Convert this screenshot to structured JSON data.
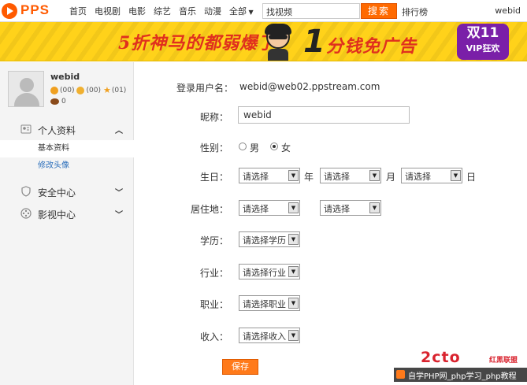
{
  "topbar": {
    "logo_text": "PPS",
    "nav": [
      "首页",
      "电视剧",
      "电影",
      "综艺",
      "音乐",
      "动漫",
      "全部"
    ],
    "search_placeholder": "找视频",
    "search_button": "搜索",
    "rank_link": "排行榜",
    "user": "webid"
  },
  "banner": {
    "text1": "5折神马的都弱爆了",
    "big_number": "1",
    "text2": "分钱免广告",
    "badge_line1": "双11",
    "badge_line2": "VIP狂欢"
  },
  "sidebar": {
    "username": "webid",
    "stats": [
      {
        "value": "(00)",
        "icon": "smile-icon",
        "color": "#f0a020"
      },
      {
        "value": "(00)",
        "icon": "moon-icon",
        "color": "#f0b030"
      },
      {
        "value": "(01)",
        "icon": "star-icon",
        "color": "#f0a020"
      }
    ],
    "coins": "0",
    "menu": [
      {
        "label": "个人资料",
        "icon": "profile-icon",
        "expanded": true,
        "items": [
          {
            "label": "基本资料",
            "active": true
          },
          {
            "label": "修改头像",
            "active": false
          }
        ]
      },
      {
        "label": "安全中心",
        "icon": "shield-icon",
        "expanded": false
      },
      {
        "label": "影视中心",
        "icon": "film-reel-icon",
        "expanded": false
      }
    ]
  },
  "form": {
    "login_label": "登录用户名：",
    "login_value": "webid@web02.ppstream.com",
    "nickname_label": "昵称：",
    "nickname_value": "webid",
    "gender_label": "性别：",
    "gender_male": "男",
    "gender_female": "女",
    "gender_selected": "女",
    "birthday_label": "生日：",
    "birthday_year": "请选择",
    "birthday_year_unit": "年",
    "birthday_month": "请选择",
    "birthday_month_unit": "月",
    "birthday_day": "请选择",
    "birthday_day_unit": "日",
    "residence_label": "居住地：",
    "residence_province": "请选择",
    "residence_city": "请选择",
    "education_label": "学历：",
    "education_value": "请选择学历",
    "industry_label": "行业：",
    "industry_value": "请选择行业",
    "occupation_label": "职业：",
    "occupation_value": "请选择职业",
    "income_label": "收入：",
    "income_value": "请选择收入",
    "save_button": "保存"
  },
  "watermark": {
    "logo": "2cto",
    "logo_small": "红黑联盟",
    "bar_text": "自学PHP网_php学习_php教程"
  }
}
